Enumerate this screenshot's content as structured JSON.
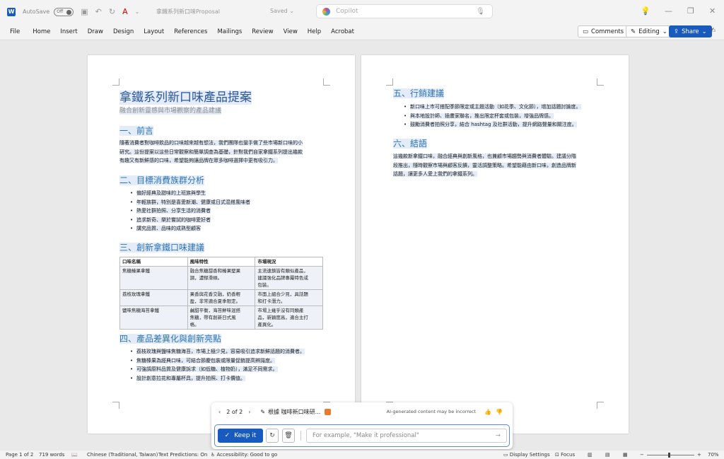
{
  "titlebar": {
    "autosave_label": "AutoSave",
    "autosave_state": "Off",
    "doc_title": "拿鐵系列新口味Proposal",
    "saved_status": "Saved",
    "copilot_placeholder": "Copilot"
  },
  "ribbon": {
    "tabs": [
      "File",
      "Home",
      "Insert",
      "Draw",
      "Design",
      "Layout",
      "References",
      "Mailings",
      "Review",
      "View",
      "Help",
      "Acrobat"
    ],
    "comments_label": "Comments",
    "editing_label": "Editing",
    "share_label": "Share"
  },
  "page1": {
    "title": "拿鐵系列新口味產品提案",
    "subtitle": "融合創新靈感與市場觀察的產品建議",
    "sec1_heading": "一、前言",
    "sec1_lines": [
      "隨著消費者對咖啡飲品的口味越來越有想法，我們團隊也蠻手做了些市場新口味的小",
      "研究。這份提案以這些日常觀察和簡單調查為基礎，針對我們自家拿鐵系列提出幾款",
      "有趣又有新鮮感的口味，希望能夠讓品牌在眾多咖啡選擇中更有吸引力。"
    ],
    "sec2_heading": "二、目標消費族群分析",
    "sec2_bullets": [
      "偏好經典及甜味的上班族與學生",
      "年輕族群，特別是喜愛新潮、健康或日式混搭風味者",
      "熱愛社群拍照、分享生活的消費者",
      "追求新奇、樂於嘗試的咖啡愛好者",
      "講究品質、品味的成熟型顧客"
    ],
    "sec3_heading": "三、創新拿鐵口味建議",
    "table": {
      "headers": [
        "口味名稱",
        "風味特性",
        "市場現況"
      ],
      "rows": [
        [
          "焦糖榛果拿鐵",
          [
            "融合焦糖甜香和榛果堅果",
            "調，濃郁滑順。"
          ],
          [
            "主流連鎖皆有類似產品，",
            "建議強化品牌專屬特色或",
            "包裝。"
          ]
        ],
        [
          "荔枝玫瑰拿鐵",
          [
            "果香與花香交融，奶香輕",
            "盈，非常適合夏季限定。"
          ],
          [
            "市面上組合少見，具話題",
            "和打卡潛力。"
          ]
        ],
        [
          "鹽味焦糖海苔拿鐵",
          [
            "鹹甜平衡，海苔鮮味混搭",
            "焦糖，帶有創新日式風",
            "格。"
          ],
          [
            "市場上幾乎沒有同類產",
            "品，新穎度高，適合主打",
            "產異化。"
          ]
        ]
      ]
    },
    "sec4_heading": "四、產品差異化與創新亮點",
    "sec4_bullets": [
      "荔枝玫瑰與鹽味焦糖海苔，市場上極少見，容易吸引追求新鮮話題的消費者。",
      "焦糖榛果為經典口味，可結合節慶包裝或限量促銷提高辨識度。",
      "可強調原料品質及健康訴求（如低糖、植物奶），滿足不同需求。",
      "設計創意拉花和專屬杯具，提升拍照、打卡價值。"
    ]
  },
  "page2": {
    "sec5_heading": "五、行銷建議",
    "sec5_bullets": [
      "新口味上市可搭配季節限定或主題活動（如花季、文化節），增加話題討論度。",
      "與本地設計師、插畫家聯名，推出限定杯套或包裝，增強品牌感。",
      "鼓勵消費者拍照分享，結合 hashtag 及社群活動，提升網路聲量和關注度。"
    ],
    "sec6_heading": "六、結語",
    "sec6_lines": [
      "這幾款新拿鐵口味，融合經典與創新風格，也兼顧市場趨勢與消費者體驗。建議分階",
      "段推出，隨時觀察市場與顧客反饋，靈活調整策略。希望能藉由新口味，創造品牌新",
      "話題，讓更多人愛上我們的拿鐵系列。"
    ]
  },
  "copilot_panel": {
    "page_counter": "2 of 2",
    "rewrite_label": "根據 咖啡新口味研...",
    "ai_disclaimer": "AI-generated content may be incorrect",
    "keep_label": "Keep it",
    "input_placeholder": "For example, \"Make it professional\""
  },
  "statusbar": {
    "page_info": "Page 1 of 2",
    "word_count": "719 words",
    "language": "Chinese (Traditional, Taiwan)",
    "text_predictions": "Text Predictions: On",
    "accessibility": "Accessibility: Good to go",
    "display_settings": "Display Settings",
    "focus_label": "Focus",
    "zoom_level": "70%"
  },
  "colors": {
    "accent": "#185abd",
    "heading": "#2e74b5",
    "highlight": "#e3ecf8"
  }
}
